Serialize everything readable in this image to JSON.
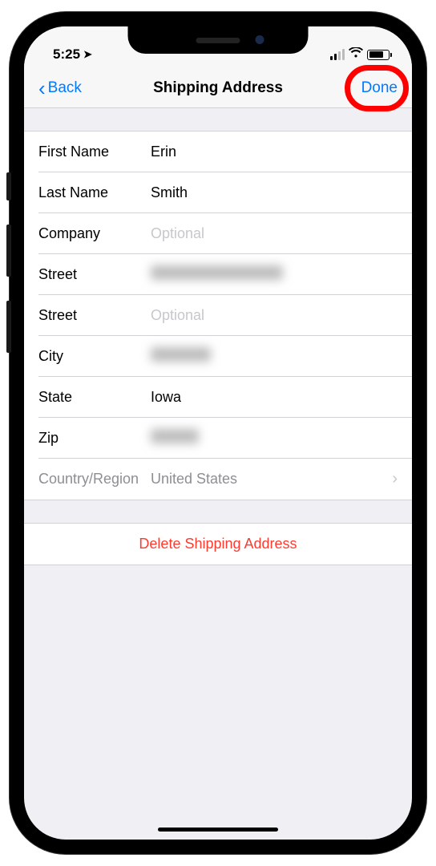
{
  "status": {
    "time": "5:25",
    "location_glyph": "➤"
  },
  "nav": {
    "back_label": "Back",
    "title": "Shipping Address",
    "done_label": "Done"
  },
  "form": {
    "first_name": {
      "label": "First Name",
      "value": "Erin"
    },
    "last_name": {
      "label": "Last Name",
      "value": "Smith"
    },
    "company": {
      "label": "Company",
      "placeholder": "Optional"
    },
    "street1": {
      "label": "Street",
      "value_redacted": true
    },
    "street2": {
      "label": "Street",
      "placeholder": "Optional"
    },
    "city": {
      "label": "City",
      "value_redacted": true
    },
    "state": {
      "label": "State",
      "value": "Iowa"
    },
    "zip": {
      "label": "Zip",
      "value_redacted": true
    },
    "country": {
      "label": "Country/Region",
      "value": "United States"
    }
  },
  "delete": {
    "label": "Delete Shipping Address"
  },
  "annotation": {
    "highlight_target": "done-button"
  }
}
